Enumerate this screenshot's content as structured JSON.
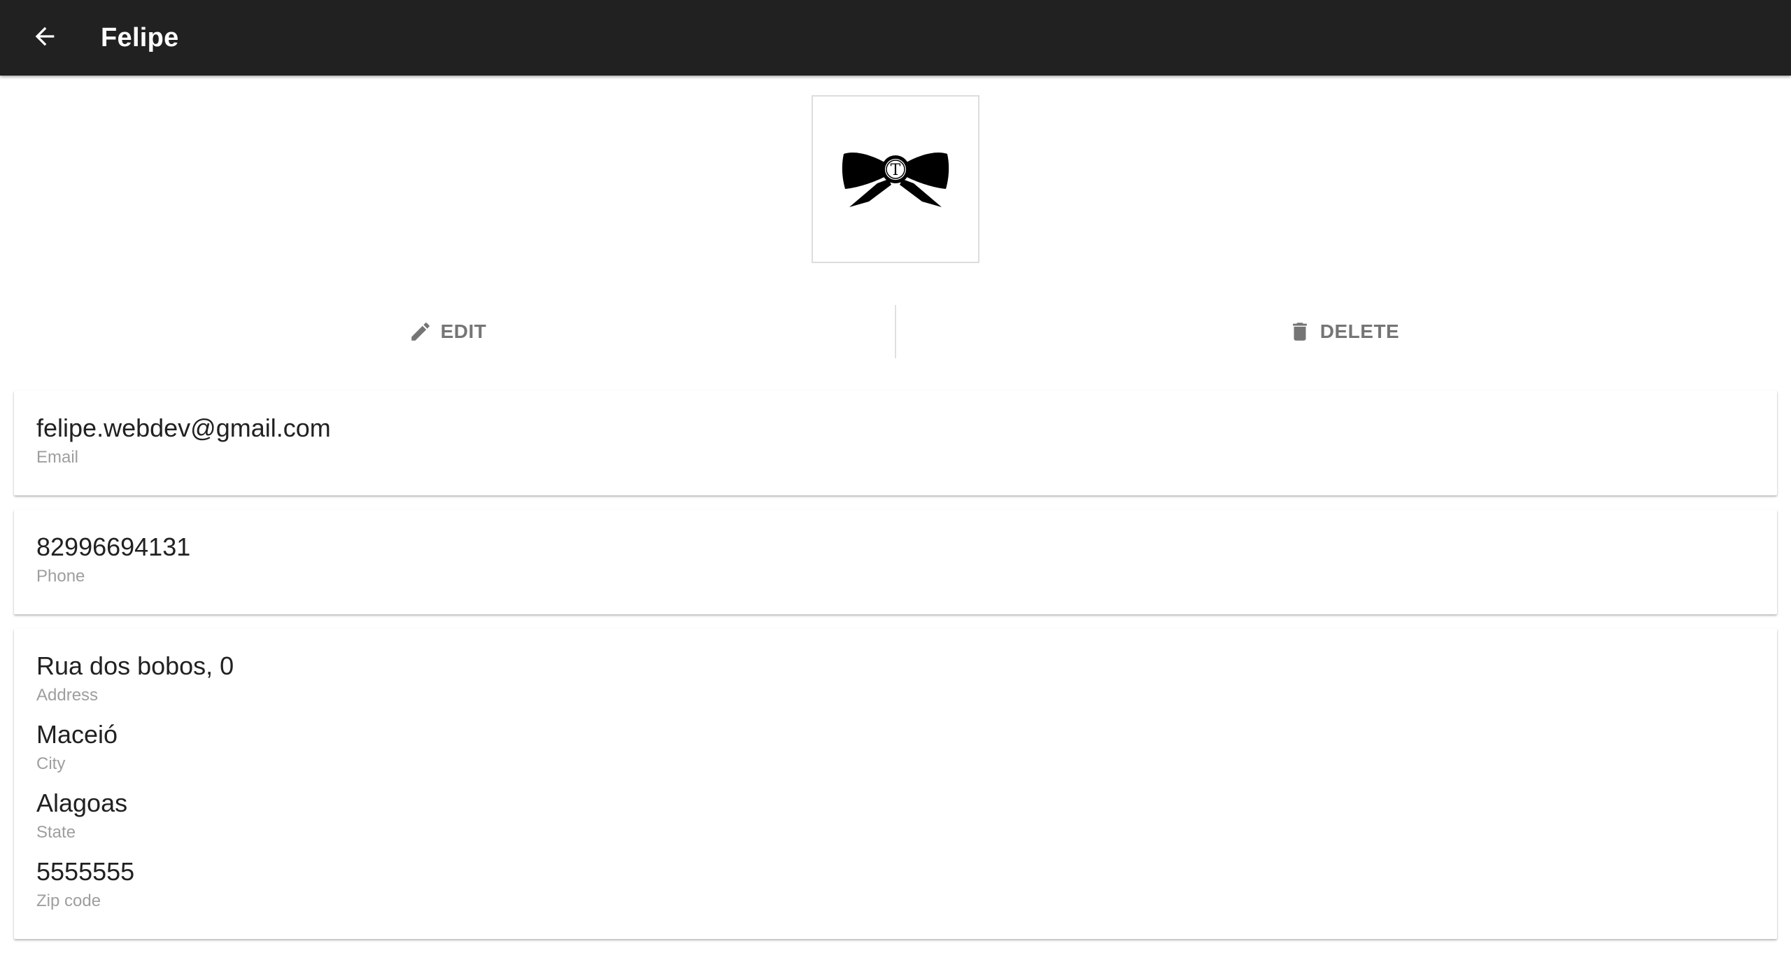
{
  "appbar": {
    "title": "Felipe",
    "back_icon": "arrow-left-icon",
    "background": "#212121"
  },
  "avatar": {
    "icon": "bow-tie-logo-icon",
    "monogram": "T"
  },
  "actions": {
    "edit_label": "EDIT",
    "edit_icon": "pencil-icon",
    "delete_label": "DELETE",
    "delete_icon": "trash-icon"
  },
  "contact": {
    "email": {
      "value": "felipe.webdev@gmail.com",
      "label": "Email"
    },
    "phone": {
      "value": "82996694131",
      "label": "Phone"
    },
    "address": {
      "value": "Rua dos bobos, 0",
      "label": "Address"
    },
    "city": {
      "value": "Maceió",
      "label": "City"
    },
    "state": {
      "value": "Alagoas",
      "label": "State"
    },
    "zip": {
      "value": "5555555",
      "label": "Zip code"
    }
  },
  "colors": {
    "text_primary": "#212121",
    "text_secondary": "#9e9e9e",
    "action_text": "#757575"
  }
}
